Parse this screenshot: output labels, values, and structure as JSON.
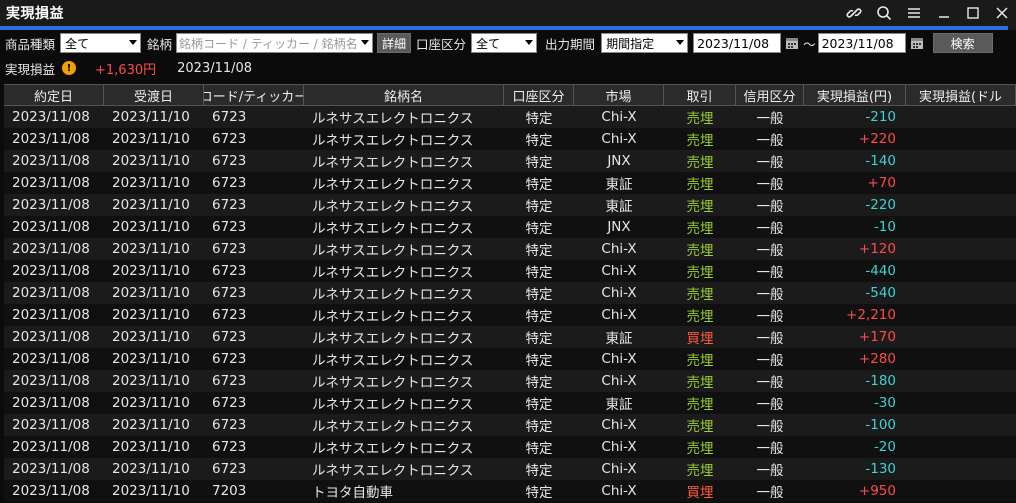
{
  "window": {
    "title": "実現損益"
  },
  "filters": {
    "product_type_label": "商品種類",
    "product_type_value": "全て",
    "stock_label": "銘柄",
    "stock_placeholder": "銘柄コード / ティッカー / 銘柄名",
    "detail_button": "詳細",
    "account_label": "口座区分",
    "account_value": "全て",
    "period_label": "出力期間",
    "period_value": "期間指定",
    "date_from": "2023/11/08",
    "tilde": "～",
    "date_to": "2023/11/08",
    "search_button": "検索"
  },
  "summary": {
    "label": "実現損益",
    "warning_glyph": "!",
    "amount": "+1,630円",
    "date": "2023/11/08"
  },
  "table": {
    "headers": [
      "約定日",
      "受渡日",
      "コード/ティッカー",
      "銘柄名",
      "口座区分",
      "市場",
      "取引",
      "信用区分",
      "実現損益(円)",
      "実現損益(ドル"
    ],
    "rows": [
      [
        "2023/11/08",
        "2023/11/10",
        "6723",
        "ルネサスエレクトロニクス",
        "特定",
        "Chi-X",
        "売埋",
        "一般",
        "-210"
      ],
      [
        "2023/11/08",
        "2023/11/10",
        "6723",
        "ルネサスエレクトロニクス",
        "特定",
        "Chi-X",
        "売埋",
        "一般",
        "+220"
      ],
      [
        "2023/11/08",
        "2023/11/10",
        "6723",
        "ルネサスエレクトロニクス",
        "特定",
        "JNX",
        "売埋",
        "一般",
        "-140"
      ],
      [
        "2023/11/08",
        "2023/11/10",
        "6723",
        "ルネサスエレクトロニクス",
        "特定",
        "東証",
        "売埋",
        "一般",
        "+70"
      ],
      [
        "2023/11/08",
        "2023/11/10",
        "6723",
        "ルネサスエレクトロニクス",
        "特定",
        "東証",
        "売埋",
        "一般",
        "-220"
      ],
      [
        "2023/11/08",
        "2023/11/10",
        "6723",
        "ルネサスエレクトロニクス",
        "特定",
        "JNX",
        "売埋",
        "一般",
        "-10"
      ],
      [
        "2023/11/08",
        "2023/11/10",
        "6723",
        "ルネサスエレクトロニクス",
        "特定",
        "Chi-X",
        "売埋",
        "一般",
        "+120"
      ],
      [
        "2023/11/08",
        "2023/11/10",
        "6723",
        "ルネサスエレクトロニクス",
        "特定",
        "Chi-X",
        "売埋",
        "一般",
        "-440"
      ],
      [
        "2023/11/08",
        "2023/11/10",
        "6723",
        "ルネサスエレクトロニクス",
        "特定",
        "Chi-X",
        "売埋",
        "一般",
        "-540"
      ],
      [
        "2023/11/08",
        "2023/11/10",
        "6723",
        "ルネサスエレクトロニクス",
        "特定",
        "Chi-X",
        "売埋",
        "一般",
        "+2,210"
      ],
      [
        "2023/11/08",
        "2023/11/10",
        "6723",
        "ルネサスエレクトロニクス",
        "特定",
        "東証",
        "買埋",
        "一般",
        "+170"
      ],
      [
        "2023/11/08",
        "2023/11/10",
        "6723",
        "ルネサスエレクトロニクス",
        "特定",
        "Chi-X",
        "売埋",
        "一般",
        "+280"
      ],
      [
        "2023/11/08",
        "2023/11/10",
        "6723",
        "ルネサスエレクトロニクス",
        "特定",
        "Chi-X",
        "売埋",
        "一般",
        "-180"
      ],
      [
        "2023/11/08",
        "2023/11/10",
        "6723",
        "ルネサスエレクトロニクス",
        "特定",
        "東証",
        "売埋",
        "一般",
        "-30"
      ],
      [
        "2023/11/08",
        "2023/11/10",
        "6723",
        "ルネサスエレクトロニクス",
        "特定",
        "Chi-X",
        "売埋",
        "一般",
        "-100"
      ],
      [
        "2023/11/08",
        "2023/11/10",
        "6723",
        "ルネサスエレクトロニクス",
        "特定",
        "Chi-X",
        "売埋",
        "一般",
        "-20"
      ],
      [
        "2023/11/08",
        "2023/11/10",
        "6723",
        "ルネサスエレクトロニクス",
        "特定",
        "Chi-X",
        "売埋",
        "一般",
        "-130"
      ],
      [
        "2023/11/08",
        "2023/11/10",
        "7203",
        "トヨタ自動車",
        "特定",
        "Chi-X",
        "買埋",
        "一般",
        "+950"
      ]
    ]
  },
  "colors": {
    "accent": "#2f6fdc",
    "positive": "#ff4a4a",
    "negative": "#3fd0d4",
    "sell": "#9acd32",
    "buy": "#ff5a3c"
  },
  "icons": {
    "link": "link-icon",
    "search": "search-icon",
    "menu": "menu-icon",
    "minimize": "minimize-icon",
    "maximize": "maximize-icon",
    "close": "close-icon",
    "calendar": "calendar-icon",
    "warning": "warning-icon"
  }
}
